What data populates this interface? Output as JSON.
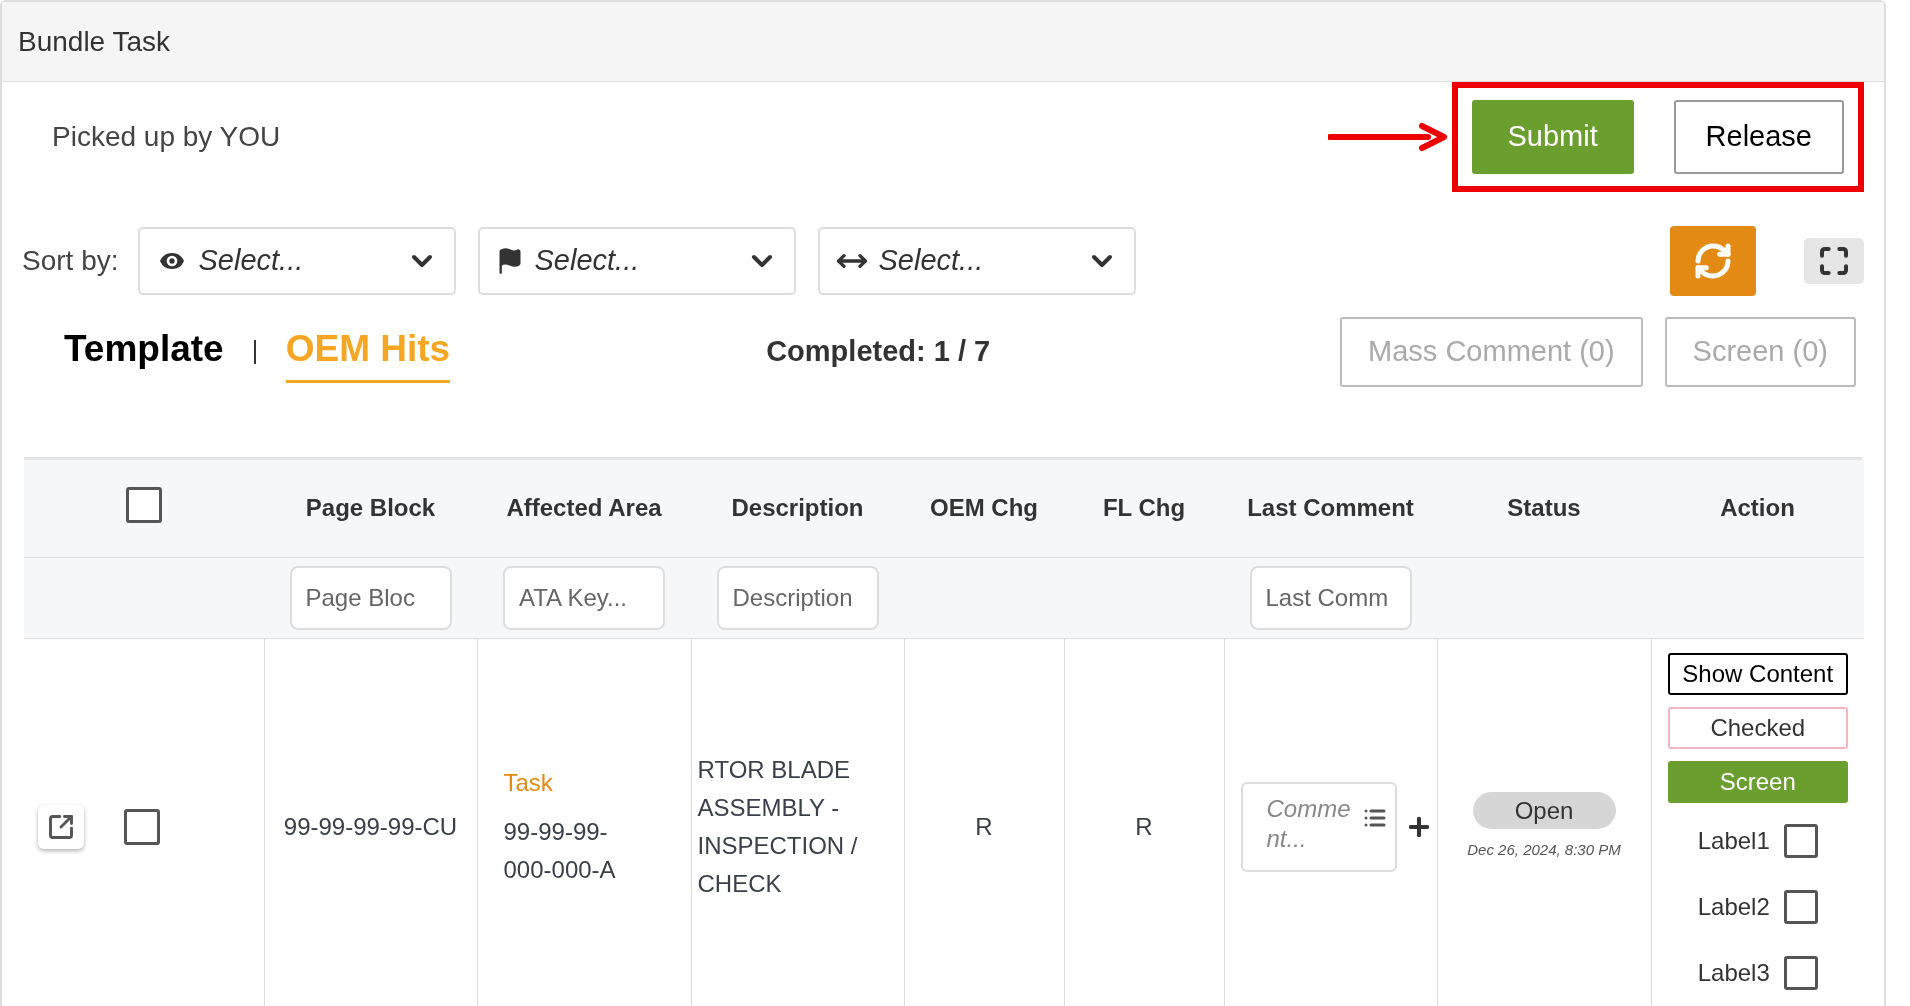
{
  "window": {
    "title": "Bundle Task"
  },
  "picked_up": "Picked up by YOU",
  "buttons": [
    {
      "label": "Submit",
      "kind": "primary"
    },
    {
      "label": "Release",
      "kind": "outline"
    }
  ],
  "sort": {
    "label": "Sort by:",
    "selects": [
      {
        "kind": "eye",
        "placeholder": "Select..."
      },
      {
        "kind": "flag",
        "placeholder": "Select..."
      },
      {
        "kind": "arrows",
        "placeholder": "Select..."
      }
    ]
  },
  "tabs": [
    {
      "label": "Template",
      "selected": false
    },
    {
      "label": "OEM Hits",
      "selected": true
    }
  ],
  "completed": "Completed: 1 / 7",
  "mass_actions": [
    {
      "label": "Mass Comment (0)",
      "disabled": true
    },
    {
      "label": "Screen (0)",
      "disabled": true
    }
  ],
  "table": {
    "select_all": {
      "checked": false
    },
    "columns": [
      {
        "label": "Page Block",
        "placeholder": "Page Bloc"
      },
      {
        "label": "Affected Area",
        "placeholder": "ATA Key..."
      },
      {
        "label": "Description",
        "placeholder": "Description"
      },
      {
        "label": "OEM Chg"
      },
      {
        "label": "FL Chg"
      },
      {
        "label": "Last Comment",
        "placeholder": "Last Comm"
      },
      {
        "label": "Status"
      },
      {
        "label": "Action"
      }
    ],
    "rows": [
      {
        "checked": false,
        "page_block": "99-99-99-99-CU",
        "area_type": "Task",
        "area": "99-99-99-000-000-A",
        "description": "RTOR BLADE ASSEMBLY - INSPECTION / CHECK",
        "oem_chg": "R",
        "fl_chg": "R",
        "comment_placeholder": "Comment...",
        "status": "Open",
        "date": "Dec 26, 2024, 8:30 PM",
        "actions": [
          {
            "label": "Show Content",
            "kind": "outline"
          },
          {
            "label": "Checked",
            "kind": "pale"
          },
          {
            "label": "Screen",
            "kind": "primary"
          }
        ],
        "labels": [
          {
            "label": "Label1",
            "checked": false
          },
          {
            "label": "Label2",
            "checked": false
          },
          {
            "label": "Label3",
            "checked": false
          }
        ]
      }
    ]
  }
}
